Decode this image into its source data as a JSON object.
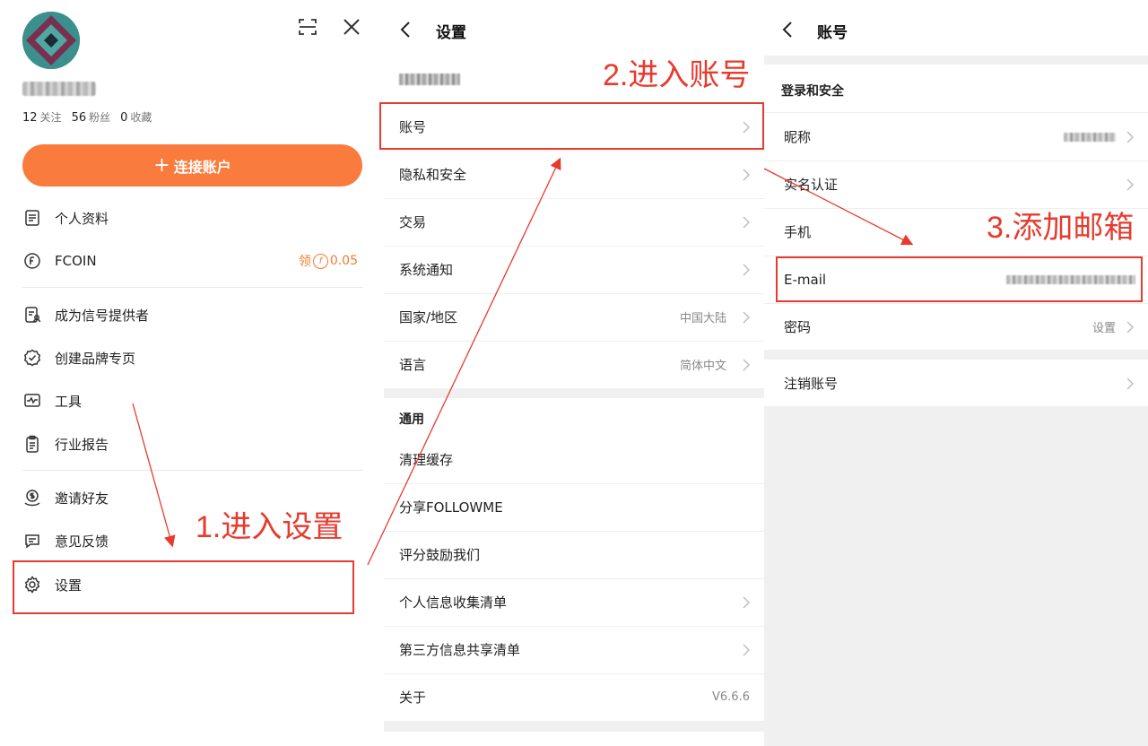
{
  "colors": {
    "accent": "#f97b3d",
    "annotation_red": "#e63b2e",
    "divider": "#e8e8e8",
    "band": "#f0f0f0"
  },
  "drawer": {
    "stats": [
      {
        "count": "12",
        "label": "关注"
      },
      {
        "count": "56",
        "label": "粉丝"
      },
      {
        "count": "0",
        "label": "收藏"
      }
    ],
    "connect_button": {
      "plus": "+",
      "label": "连接账户"
    },
    "menu": [
      {
        "label": "个人资料",
        "icon": "document-icon"
      },
      {
        "label": "FCOIN",
        "icon": "fcoin-icon",
        "right": {
          "prefix": "领",
          "coin": "f",
          "value": "0.05"
        }
      },
      {
        "label": "成为信号提供者",
        "icon": "provider-icon"
      },
      {
        "label": "创建品牌专页",
        "icon": "badge-check-icon"
      },
      {
        "label": "工具",
        "icon": "chart-tool-icon"
      },
      {
        "label": "行业报告",
        "icon": "clipboard-icon"
      },
      {
        "label": "邀请好友",
        "icon": "invite-icon"
      },
      {
        "label": "意见反馈",
        "icon": "feedback-icon"
      },
      {
        "label": "设置",
        "icon": "gear-icon"
      }
    ],
    "annotation": "1.进入设置"
  },
  "settings": {
    "title": "设置",
    "annotation": "2.进入账号",
    "rows": [
      {
        "label": "账号",
        "value": "",
        "arrow": true
      },
      {
        "label": "隐私和安全",
        "value": "",
        "arrow": true
      },
      {
        "label": "交易",
        "value": "",
        "arrow": true
      },
      {
        "label": "系统通知",
        "value": "",
        "arrow": true
      },
      {
        "label": "国家/地区",
        "value": "中国大陆",
        "arrow": true
      },
      {
        "label": "语言",
        "value": "简体中文",
        "arrow": true
      }
    ],
    "general_section": "通用",
    "general_rows": [
      {
        "label": "清理缓存",
        "value": "",
        "arrow": false
      },
      {
        "label": "分享FOLLOWME",
        "value": "",
        "arrow": false
      },
      {
        "label": "评分鼓励我们",
        "value": "",
        "arrow": false
      },
      {
        "label": "个人信息收集清单",
        "value": "",
        "arrow": true
      },
      {
        "label": "第三方信息共享清单",
        "value": "",
        "arrow": true
      },
      {
        "label": "关于",
        "value": "V6.6.6",
        "arrow": false
      }
    ]
  },
  "account": {
    "title": "账号",
    "section": "登录和安全",
    "annotation": "3.添加邮箱",
    "rows": [
      {
        "label": "昵称",
        "value": "",
        "arrow": true
      },
      {
        "label": "实名认证",
        "value": "",
        "arrow": true
      },
      {
        "label": "手机",
        "value": "",
        "arrow": false
      },
      {
        "label": "E-mail",
        "value": "",
        "arrow": false
      },
      {
        "label": "密码",
        "value": "设置",
        "arrow": true
      }
    ],
    "delete_row": {
      "label": "注销账号",
      "arrow": true
    }
  }
}
